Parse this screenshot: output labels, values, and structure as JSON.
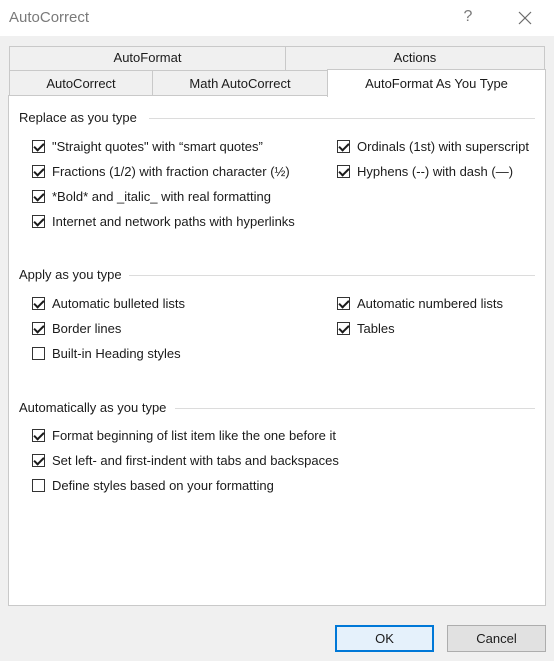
{
  "window": {
    "title": "AutoCorrect",
    "help_label": "?"
  },
  "tabs": {
    "row1": [
      {
        "label": "AutoFormat",
        "active": false
      },
      {
        "label": "Actions",
        "active": false
      }
    ],
    "row2": [
      {
        "label": "AutoCorrect",
        "active": false
      },
      {
        "label": "Math AutoCorrect",
        "active": false
      },
      {
        "label": "AutoFormat As You Type",
        "active": true
      }
    ]
  },
  "groups": {
    "replace": {
      "title": "Replace as you type",
      "options": [
        {
          "label": "\"Straight quotes\" with “smart quotes”",
          "checked": true
        },
        {
          "label": "Fractions (1/2) with fraction character (½)",
          "checked": true
        },
        {
          "label": "*Bold* and _italic_ with real formatting",
          "checked": true
        },
        {
          "label": "Internet and network paths with hyperlinks",
          "checked": true
        },
        {
          "label": "Ordinals (1st) with superscript",
          "checked": true
        },
        {
          "label": "Hyphens (--) with dash (—)",
          "checked": true
        }
      ]
    },
    "apply": {
      "title": "Apply as you type",
      "options": [
        {
          "label": "Automatic bulleted lists",
          "checked": true
        },
        {
          "label": "Border lines",
          "checked": true
        },
        {
          "label": "Built-in Heading styles",
          "checked": false
        },
        {
          "label": "Automatic numbered lists",
          "checked": true
        },
        {
          "label": "Tables",
          "checked": true
        }
      ]
    },
    "auto": {
      "title": "Automatically as you type",
      "options": [
        {
          "label": "Format beginning of list item like the one before it",
          "checked": true
        },
        {
          "label": "Set left- and first-indent with tabs and backspaces",
          "checked": true
        },
        {
          "label": "Define styles based on your formatting",
          "checked": false
        }
      ]
    }
  },
  "buttons": {
    "ok": "OK",
    "cancel": "Cancel"
  }
}
